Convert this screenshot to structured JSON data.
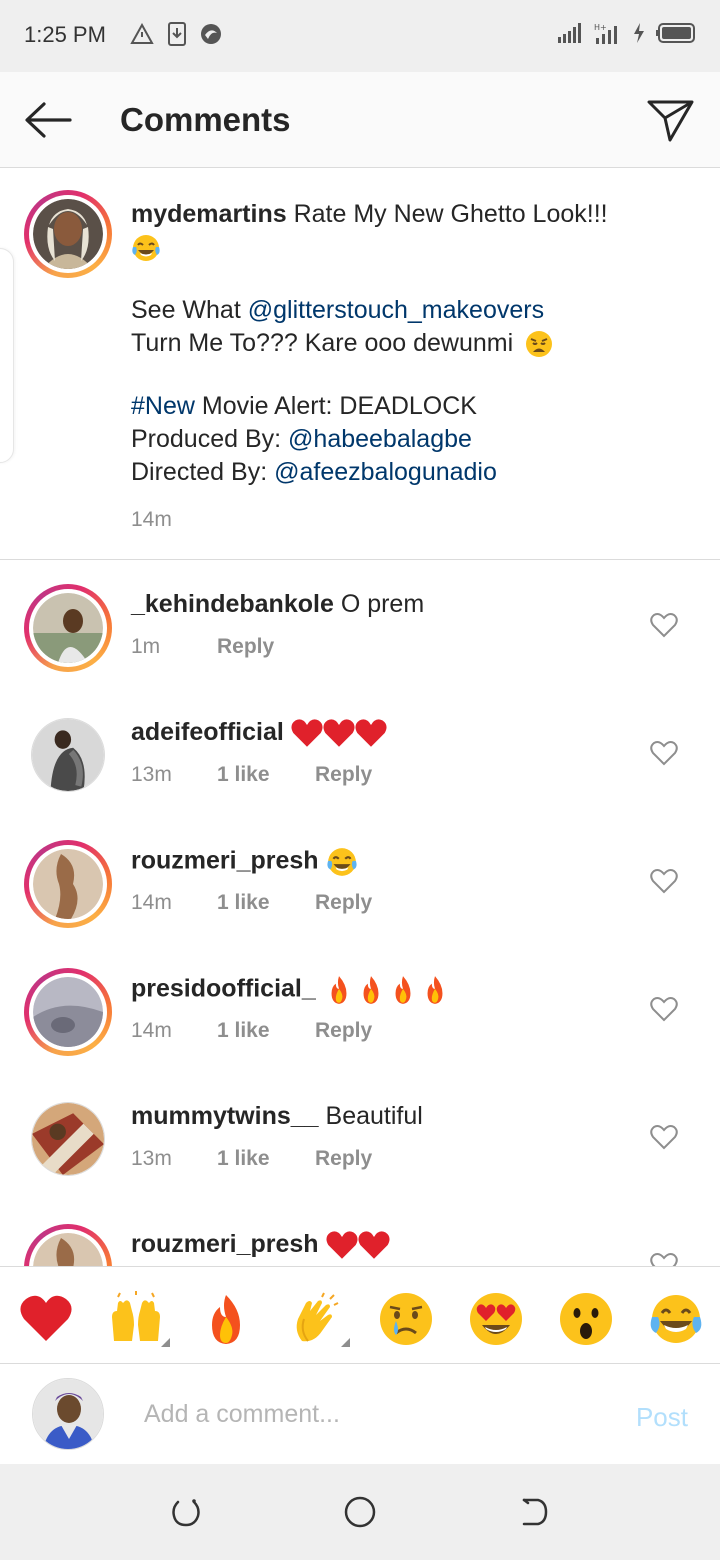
{
  "status_bar": {
    "time": "1:25 PM",
    "left_icons": [
      "warning-icon",
      "download-icon",
      "app-icon"
    ],
    "right_icons": [
      "signal-icon",
      "signal-2-icon",
      "charging-icon",
      "battery-icon"
    ]
  },
  "header": {
    "title": "Comments",
    "back_icon": "arrow-left-icon",
    "share_icon": "paper-plane-icon"
  },
  "caption": {
    "username": "mydemartins",
    "line1": "Rate My New Ghetto Look!!!",
    "p2_prefix": "See What ",
    "p2_mention": "@glitterstouch_makeovers",
    "p2_line2": "Turn Me To??? Kare ooo dewunmi",
    "p3_hashtag": "#New",
    "p3_rest": " Movie Alert: DEADLOCK",
    "p3_produced_label": "Produced By: ",
    "p3_produced_mention": "@habeebalagbe",
    "p3_directed_label": "Directed By: ",
    "p3_directed_mention": "@afeezbalogunadio",
    "time": "14m"
  },
  "comments": [
    {
      "username": "_kehindebankole",
      "text": "O prem",
      "time": "1m",
      "likes": "",
      "reply": "Reply",
      "emoji": []
    },
    {
      "username": "adeifeofficial",
      "text": "",
      "time": "13m",
      "likes": "1 like",
      "reply": "Reply",
      "emoji": [
        "heart",
        "heart",
        "heart"
      ]
    },
    {
      "username": "rouzmeri_presh",
      "text": "",
      "time": "14m",
      "likes": "1 like",
      "reply": "Reply",
      "emoji": [
        "laugh"
      ]
    },
    {
      "username": "presidoofficial_",
      "text": "",
      "time": "14m",
      "likes": "1 like",
      "reply": "Reply",
      "emoji": [
        "fire",
        "fire",
        "fire",
        "fire"
      ]
    },
    {
      "username": "mummytwins__",
      "text": "Beautiful",
      "time": "13m",
      "likes": "1 like",
      "reply": "Reply",
      "emoji": []
    },
    {
      "username": "rouzmeri_presh",
      "text": "",
      "time": "",
      "likes": "",
      "reply": "",
      "emoji": [
        "heart",
        "heart"
      ]
    }
  ],
  "emoji_bar": [
    "heart",
    "raised-hands",
    "fire",
    "clapping-hands",
    "crying-face",
    "heart-eyes",
    "surprised-face",
    "tears-of-joy"
  ],
  "input": {
    "placeholder": "Add a comment...",
    "post_label": "Post"
  },
  "colors": {
    "mention": "#00376b",
    "secondary_text": "#8e8e8e",
    "post_disabled": "#b2dffc",
    "heart_red": "#e0212b"
  },
  "nav": [
    "recents-icon",
    "home-icon",
    "back-icon"
  ]
}
